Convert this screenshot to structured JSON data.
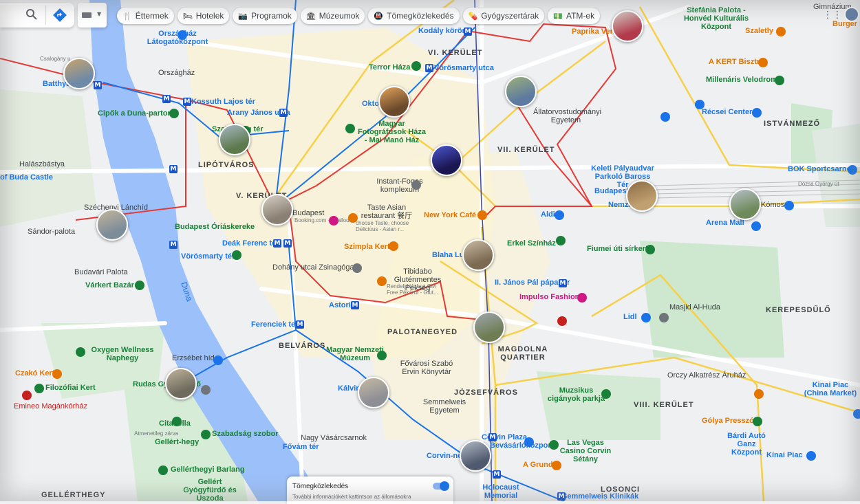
{
  "toolbar": {
    "search_icon": "search-icon",
    "directions_icon": "directions-icon",
    "chips": [
      {
        "icon": "🍴",
        "label": "Éttermek"
      },
      {
        "icon": "🛏",
        "label": "Hotelek"
      },
      {
        "icon": "📷",
        "label": "Programok"
      },
      {
        "icon": "🏛",
        "label": "Múzeumok"
      },
      {
        "icon": "🚇",
        "label": "Tömegközlekedés"
      },
      {
        "icon": "💊",
        "label": "Gyógyszertárak"
      },
      {
        "icon": "💵",
        "label": "ATM-ek"
      }
    ]
  },
  "transit_card": {
    "title": "Tömegközlekedés",
    "subtitle": "További információkért kattintson az állomásokra"
  },
  "colors": {
    "water": "#9cc0f9",
    "park": "#c8e6c9",
    "metro_blue": "#1a56c8",
    "tram_yellow": "#f7d04a",
    "red_line": "#e53935",
    "road": "#ffffff"
  },
  "map": {
    "districts": [
      {
        "name": "LIPÓTVÁROS"
      },
      {
        "name": "BELVÁROS"
      },
      {
        "name": "PALOTANEGYED"
      },
      {
        "name": "JÓZSEFVÁROS"
      },
      {
        "name": "MAGDOLNA QUARTIER"
      },
      {
        "name": "KEREPESDŰLŐ"
      },
      {
        "name": "ISTVÁNMEZŐ"
      },
      {
        "name": "GELLÉRTHEGY"
      },
      {
        "name": "LOSONCI"
      },
      {
        "name": "VI. KERÜLET"
      },
      {
        "name": "VII. KERÜLET"
      },
      {
        "name": "V. KERÜLET"
      },
      {
        "name": "VIII. KERÜLET"
      }
    ],
    "places": [
      {
        "name": "Országház Látogatóközpont",
        "kind": "poi"
      },
      {
        "name": "Országház",
        "kind": "dark"
      },
      {
        "name": "Csalogány u.",
        "kind": "street"
      },
      {
        "name": "Batthyány",
        "kind": "poi"
      },
      {
        "name": "Kossuth Lajos tér",
        "kind": "poi"
      },
      {
        "name": "Arany János utca",
        "kind": "poi"
      },
      {
        "name": "Cipők a Duna-parton",
        "kind": "green"
      },
      {
        "name": "Szabadság tér",
        "kind": "green"
      },
      {
        "name": "Halászbástya",
        "kind": "dark"
      },
      {
        "name": "of Buda Castle",
        "kind": "poi"
      },
      {
        "name": "Széchenyi Lánchíd",
        "kind": "dark"
      },
      {
        "name": "Sándor-palota",
        "kind": "dark"
      },
      {
        "name": "Budavári Palota",
        "kind": "dark"
      },
      {
        "name": "Várkert Bazár",
        "kind": "green"
      },
      {
        "name": "Budapest Óriáskereke",
        "kind": "green"
      },
      {
        "name": "Deák Ferenc tér",
        "kind": "poi"
      },
      {
        "name": "Vörösmarty tér",
        "kind": "poi"
      },
      {
        "name": "Dohány utcai Zsinagóga",
        "kind": "dark"
      },
      {
        "name": "Budapest",
        "kind": "dark"
      },
      {
        "name": "Booking.com - Szalloda",
        "kind": "tiny"
      },
      {
        "name": "Taste Asian restaurant 餐厅",
        "kind": "dark"
      },
      {
        "name": "choose Taste, choose Delicious - Asian r...",
        "kind": "tiny"
      },
      {
        "name": "Szimpla Kert",
        "kind": "orange"
      },
      {
        "name": "Tibidabo Gluténmentes Pékség",
        "kind": "dark"
      },
      {
        "name": "Rendelj Házhoz GM Free Pékárut - Glut...",
        "kind": "tiny"
      },
      {
        "name": "Instant-Fogas komplexum",
        "kind": "dark"
      },
      {
        "name": "Terror Háza",
        "kind": "green"
      },
      {
        "name": "Vörösmarty utca",
        "kind": "poi"
      },
      {
        "name": "Kodály körönd",
        "kind": "poi"
      },
      {
        "name": "Oktogon",
        "kind": "poi"
      },
      {
        "name": "Magyar Fotográfusok Háza - Mai Manó Ház",
        "kind": "green"
      },
      {
        "name": "New York Café",
        "kind": "orange"
      },
      {
        "name": "Blaha Lujza",
        "kind": "poi"
      },
      {
        "name": "Erkel Színház",
        "kind": "green"
      },
      {
        "name": "Aldi",
        "kind": "poi"
      },
      {
        "name": "II. János Pál pápa tér",
        "kind": "poi"
      },
      {
        "name": "Impulso Fashion",
        "kind": "pink"
      },
      {
        "name": "Fiumei úti sírkert",
        "kind": "green"
      },
      {
        "name": "Keleti Pályaudvar Parkoló Baross Tér",
        "kind": "poi"
      },
      {
        "name": "Budapest-Keleti",
        "kind": "poi"
      },
      {
        "name": "Nemzeti",
        "kind": "poi"
      },
      {
        "name": "Arena Mall",
        "kind": "poi"
      },
      {
        "name": "Kómosó",
        "kind": "dark"
      },
      {
        "name": "Állatorvostudományi Egyetem",
        "kind": "dark"
      },
      {
        "name": "Récsei Center",
        "kind": "poi"
      },
      {
        "name": "Millenáris Velodrom",
        "kind": "green"
      },
      {
        "name": "A KERT Bisztró",
        "kind": "orange"
      },
      {
        "name": "Szaletly",
        "kind": "orange"
      },
      {
        "name": "Paprika Vendéglő",
        "kind": "orange"
      },
      {
        "name": "Stefánia Palota - Honvéd Kulturális Központ",
        "kind": "green"
      },
      {
        "name": "Gimnázium",
        "kind": "dark"
      },
      {
        "name": "Burger Ki",
        "kind": "orange"
      },
      {
        "name": "BOK Sportcsarnok",
        "kind": "poi"
      },
      {
        "name": "Dózsa György út",
        "kind": "street"
      },
      {
        "name": "Masjid Al-Huda",
        "kind": "dark"
      },
      {
        "name": "Lidl",
        "kind": "poi"
      },
      {
        "name": "Orczy Alkatrész Áruház",
        "kind": "dark"
      },
      {
        "name": "Kinai Piac (China Market)",
        "kind": "poi"
      },
      {
        "name": "Gólya Presszó",
        "kind": "orange"
      },
      {
        "name": "Bárdi Autó Ganz Központ",
        "kind": "poi"
      },
      {
        "name": "Kínai Piac",
        "kind": "poi"
      },
      {
        "name": "Muzsikus cigányok parkja",
        "kind": "green"
      },
      {
        "name": "Las Vegas Casino Corvin Sétány",
        "kind": "green"
      },
      {
        "name": "Corvin Plaza",
        "kind": "poi"
      },
      {
        "name": "Bevásárlóközpont",
        "kind": "poi"
      },
      {
        "name": "Corvin-negyed",
        "kind": "poi"
      },
      {
        "name": "A Grund",
        "kind": "orange"
      },
      {
        "name": "Holocaust Memorial Center",
        "kind": "poi"
      },
      {
        "name": "Semmelweis Klinikák",
        "kind": "poi"
      },
      {
        "name": "Semmelweis Egyetem",
        "kind": "dark"
      },
      {
        "name": "Kálvin tér",
        "kind": "poi"
      },
      {
        "name": "Fővárosi Szabó Ervin Könyvtár",
        "kind": "dark"
      },
      {
        "name": "Magyar Nemzeti Múzeum",
        "kind": "green"
      },
      {
        "name": "Astoria",
        "kind": "poi"
      },
      {
        "name": "Ferenciek tere",
        "kind": "poi"
      },
      {
        "name": "Erzsébet híd",
        "kind": "dark"
      },
      {
        "name": "Rudas Gyógyfürdő",
        "kind": "green"
      },
      {
        "name": "Nagy Vásárcsarnok",
        "kind": "dark"
      },
      {
        "name": "Fővám tér",
        "kind": "poi"
      },
      {
        "name": "Szabadság szobor",
        "kind": "green"
      },
      {
        "name": "Citadella",
        "kind": "green"
      },
      {
        "name": "Gellért-hegy",
        "kind": "green"
      },
      {
        "name": "Gellérthegyi Barlang",
        "kind": "green"
      },
      {
        "name": "Gellért Gyógyfürdő és Uszoda",
        "kind": "green"
      },
      {
        "name": "Oxygen Wellness Naphegy",
        "kind": "green"
      },
      {
        "name": "Czakó Kert",
        "kind": "orange"
      },
      {
        "name": "Filozófiai Kert",
        "kind": "green"
      },
      {
        "name": "Emineo Magánkórház",
        "kind": "red"
      },
      {
        "name": "Duna",
        "kind": "poi"
      },
      {
        "name": "Atmenetileg zárva",
        "kind": "street"
      }
    ]
  }
}
